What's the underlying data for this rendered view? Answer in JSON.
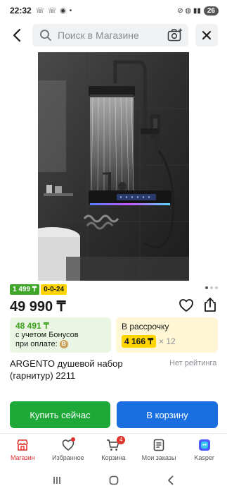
{
  "status_bar": {
    "time": "22:32",
    "left_icons": "☏ ☏ ◉ •",
    "right_icons": "⊘ ◍ ▮▮",
    "battery": "26"
  },
  "search": {
    "placeholder": "Поиск в Магазине"
  },
  "product": {
    "badge_bonus": "1 499 ₸",
    "badge_installment": "0-0-24",
    "price": "49 990 ₸",
    "bonus_amount": "48 491 ₸",
    "bonus_line1": "с учетом Бонусов",
    "bonus_line2": "при оплате:",
    "installment_label": "В рассрочку",
    "installment_amount": "4 166 ₸",
    "installment_months": "× 12",
    "title": "ARGENTO душевой набор (гарнитур) 2211",
    "rating": "Нет рейтинга"
  },
  "actions": {
    "buy_now": "Купить сейчас",
    "add_to_cart": "В корзину"
  },
  "tab_bar": {
    "items": [
      {
        "label": "Магазин",
        "icon": "store-icon"
      },
      {
        "label": "Избранное",
        "icon": "heart-icon"
      },
      {
        "label": "Корзина",
        "icon": "cart-icon",
        "count": "4"
      },
      {
        "label": "Мои заказы",
        "icon": "orders-icon"
      },
      {
        "label": "Kasper",
        "icon": "kasper-icon"
      }
    ]
  },
  "colors": {
    "accent_green": "#1ea838",
    "accent_blue": "#1a6fe0",
    "accent_red": "#e0332d",
    "badge_yellow": "#ffd400"
  }
}
